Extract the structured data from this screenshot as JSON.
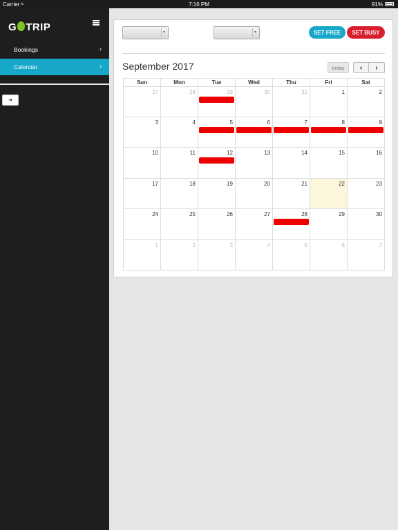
{
  "status": {
    "carrier": "Carrier",
    "time": "7:16 PM",
    "battery": "91%"
  },
  "sidebar": {
    "logo": {
      "prefix": "G",
      "suffix": "TRIP",
      "accent": "#7ec224"
    },
    "items": [
      {
        "label": "Bookings",
        "active": false
      },
      {
        "label": "Calendar",
        "active": true
      }
    ]
  },
  "toolbar": {
    "select1_value": "",
    "select2_value": "",
    "set_free_label": "SET FREE",
    "set_busy_label": "SET BUSY"
  },
  "calendar": {
    "title": "September 2017",
    "today_label": "today",
    "weekdays": [
      "Sun",
      "Mon",
      "Tue",
      "Wed",
      "Thu",
      "Fri",
      "Sat"
    ],
    "weeks": [
      [
        {
          "d": "27",
          "other": true
        },
        {
          "d": "28",
          "other": true
        },
        {
          "d": "29",
          "other": true,
          "busy": true
        },
        {
          "d": "30",
          "other": true
        },
        {
          "d": "31",
          "other": true
        },
        {
          "d": "1"
        },
        {
          "d": "2"
        }
      ],
      [
        {
          "d": "3"
        },
        {
          "d": "4"
        },
        {
          "d": "5",
          "busy": true
        },
        {
          "d": "6",
          "busy": true
        },
        {
          "d": "7",
          "busy": true
        },
        {
          "d": "8",
          "busy": true
        },
        {
          "d": "9",
          "busy": true
        }
      ],
      [
        {
          "d": "10"
        },
        {
          "d": "11"
        },
        {
          "d": "12",
          "busy": true
        },
        {
          "d": "13"
        },
        {
          "d": "14"
        },
        {
          "d": "15"
        },
        {
          "d": "16"
        }
      ],
      [
        {
          "d": "17"
        },
        {
          "d": "18"
        },
        {
          "d": "19"
        },
        {
          "d": "20"
        },
        {
          "d": "21"
        },
        {
          "d": "22",
          "today": true
        },
        {
          "d": "23"
        }
      ],
      [
        {
          "d": "24"
        },
        {
          "d": "25"
        },
        {
          "d": "26"
        },
        {
          "d": "27"
        },
        {
          "d": "28",
          "busy": true
        },
        {
          "d": "29"
        },
        {
          "d": "30"
        }
      ],
      [
        {
          "d": "1",
          "other": true
        },
        {
          "d": "2",
          "other": true
        },
        {
          "d": "3",
          "other": true
        },
        {
          "d": "4",
          "other": true
        },
        {
          "d": "5",
          "other": true
        },
        {
          "d": "6",
          "other": true
        },
        {
          "d": "7",
          "other": true
        }
      ]
    ],
    "colors": {
      "busy": "#ee0000",
      "today": "#fbf6dc",
      "accent": "#17a8c9",
      "danger": "#d81f2e"
    }
  }
}
